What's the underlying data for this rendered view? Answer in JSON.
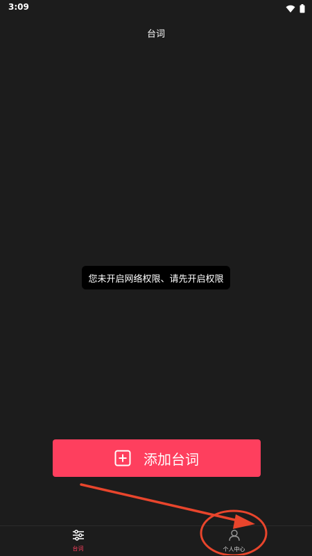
{
  "status_bar": {
    "time": "3:09",
    "icons": [
      "wifi-icon",
      "battery-icon"
    ]
  },
  "header": {
    "title": "台词"
  },
  "toast": {
    "message": "您未开启网络权限、请先开启权限"
  },
  "add_button": {
    "label": "添加台词",
    "icon": "plus-square-icon",
    "color": "#fe3f5e"
  },
  "tab_bar": {
    "tabs": [
      {
        "label": "台词",
        "icon": "sliders-icon",
        "active": true
      },
      {
        "label": "个人中心",
        "icon": "person-icon",
        "active": false
      }
    ]
  },
  "colors": {
    "background": "#1c1c1c",
    "accent": "#fe3f5e",
    "annotation": "#e8452c"
  }
}
